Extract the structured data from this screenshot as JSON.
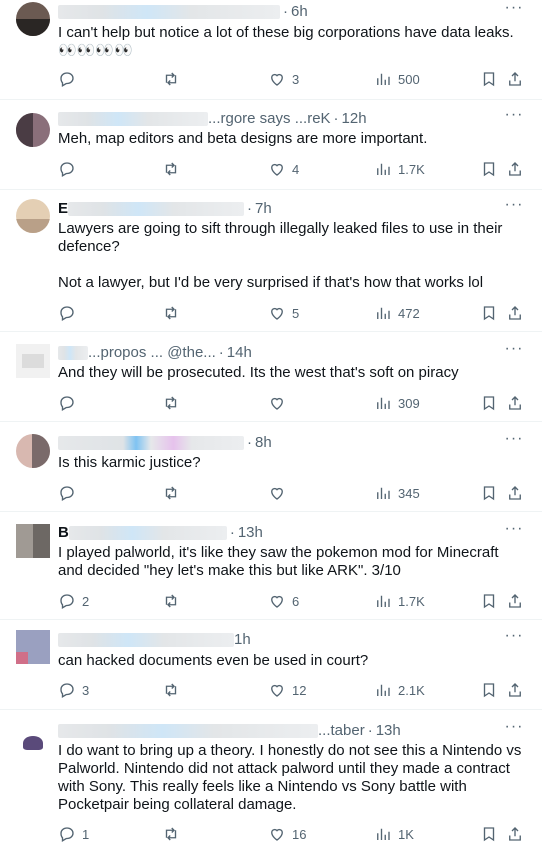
{
  "tweets": [
    {
      "name_prefix": "",
      "name_suffix": "",
      "time": "6h",
      "text": "I can't help but notice a lot of these big corporations have data leaks. 👀👀👀👀",
      "replies": "",
      "retweets": "",
      "likes": "3",
      "views": "500",
      "avatar_colors": [
        "#6b5a52",
        "#2a2624"
      ]
    },
    {
      "name_prefix": "",
      "name_suffix": "...rgore says ...reK",
      "time": "12h",
      "text": "Meh, map editors and beta designs are more important.",
      "replies": "",
      "retweets": "",
      "likes": "4",
      "views": "1.7K",
      "avatar_colors": [
        "#8a6f7a",
        "#4a3c44"
      ]
    },
    {
      "name_prefix": "E",
      "name_suffix": "",
      "time": "7h",
      "text": "Lawyers are going to sift through illegally leaked files to use in their defence?\n\nNot a lawyer, but I'd be very surprised if that's how that works lol",
      "replies": "",
      "retweets": "",
      "likes": "5",
      "views": "472",
      "avatar_colors": [
        "#e4cfb4",
        "#b9a088"
      ]
    },
    {
      "name_prefix": "",
      "name_suffix": "...propos ... @the...",
      "time": "14h",
      "text": "And they will be prosecuted. Its the west that's soft on piracy",
      "replies": "",
      "retweets": "",
      "likes": "",
      "views": "309",
      "avatar_colors": [
        "#f1f1f1",
        "#dcdcdc"
      ]
    },
    {
      "name_prefix": "",
      "name_suffix": "",
      "time": "8h",
      "text": "Is this karmic justice?",
      "replies": "",
      "retweets": "",
      "likes": "",
      "views": "345",
      "avatar_colors": [
        "#d8b8b0",
        "#7a6a6a"
      ]
    },
    {
      "name_prefix": "B",
      "name_suffix": "",
      "time": "13h",
      "text": "I played palworld, it's like they saw the pokemon mod for Minecraft and decided \"hey let's make this but like ARK\". 3/10",
      "replies": "2",
      "retweets": "",
      "likes": "6",
      "views": "1.7K",
      "avatar_colors": [
        "#a09a94",
        "#6d6864"
      ]
    },
    {
      "name_prefix": "",
      "name_suffix": "",
      "time": "1h",
      "text": "can hacked documents even be used in court?",
      "replies": "3",
      "retweets": "",
      "likes": "12",
      "views": "2.1K",
      "avatar_colors": [
        "#9aa0c0",
        "#d06f88"
      ]
    },
    {
      "name_prefix": "",
      "name_suffix": "...taber",
      "time": "13h",
      "text": "I do want to bring up a theory. I honestly do not see this a Nintendo vs Palworld. Nintendo did not attack palword until they made a contract with Sony. This really feels like a Nintendo vs Sony battle with Pocketpair being collateral damage.",
      "replies": "1",
      "retweets": "",
      "likes": "16",
      "views": "1K",
      "avatar_colors": [
        "#5a4a7a",
        "#ffffff"
      ]
    }
  ]
}
